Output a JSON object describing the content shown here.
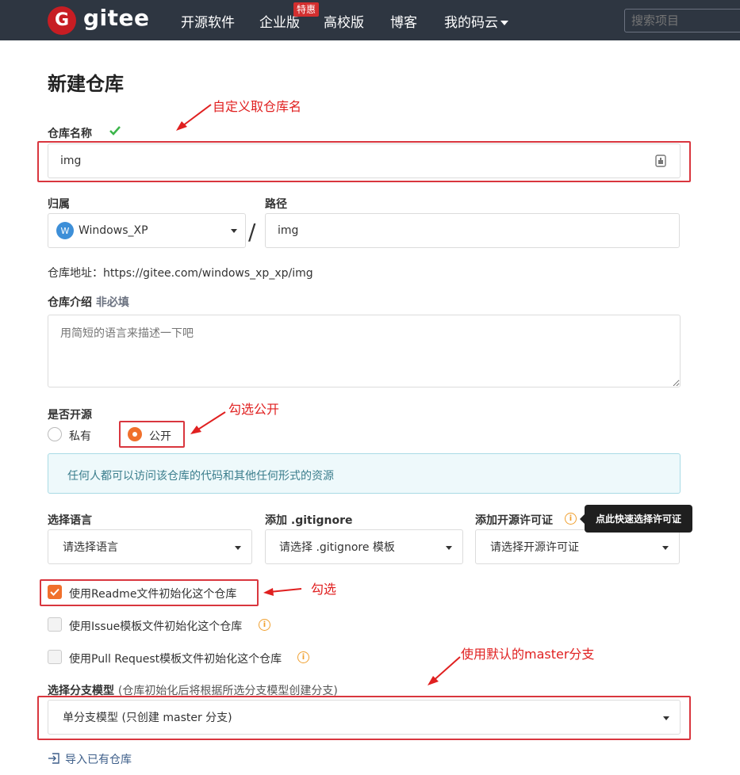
{
  "header": {
    "logo_glyph": "G",
    "logo_text": "gitee",
    "nav": [
      "开源软件",
      "企业版",
      "高校版",
      "博客",
      "我的码云"
    ],
    "badge": "特惠",
    "search_placeholder": "搜索项目"
  },
  "page": {
    "title": "新建仓库"
  },
  "repo_name": {
    "label": "仓库名称",
    "value": "img"
  },
  "owner": {
    "label": "归属",
    "avatar_letter": "W",
    "value": "Windows_XP"
  },
  "slash": "/",
  "path": {
    "label": "路径",
    "value": "img"
  },
  "repo_address": "仓库地址：https://gitee.com/windows_xp_xp/img",
  "intro": {
    "label": "仓库介绍",
    "optional": "非必填",
    "placeholder": "用简短的语言来描述一下吧"
  },
  "visibility": {
    "label": "是否开源",
    "private": "私有",
    "public": "公开",
    "info": "任何人都可以访问该仓库的代码和其他任何形式的资源"
  },
  "language": {
    "label": "选择语言",
    "value": "请选择语言"
  },
  "gitignore": {
    "label": "添加 .gitignore",
    "value": "请选择 .gitignore 模板"
  },
  "license": {
    "label": "添加开源许可证",
    "value": "请选择开源许可证",
    "tooltip": "点此快速选择许可证"
  },
  "init_options": {
    "readme": "使用Readme文件初始化这个仓库",
    "issue": "使用Issue模板文件初始化这个仓库",
    "pr": "使用Pull Request模板文件初始化这个仓库"
  },
  "branch_model": {
    "label": "选择分支模型",
    "hint": "(仓库初始化后将根据所选分支模型创建分支)",
    "value": "单分支模型 (只创建 master 分支)"
  },
  "import_link": "导入已有仓库",
  "annotations": {
    "name": "自定义取仓库名",
    "public": "勾选公开",
    "readme": "勾选",
    "master": "使用默认的master分支"
  },
  "colors": {
    "topbar": "#2e3641",
    "brand": "#c71d23",
    "accent": "#f0702c",
    "annotation": "#e02020"
  }
}
